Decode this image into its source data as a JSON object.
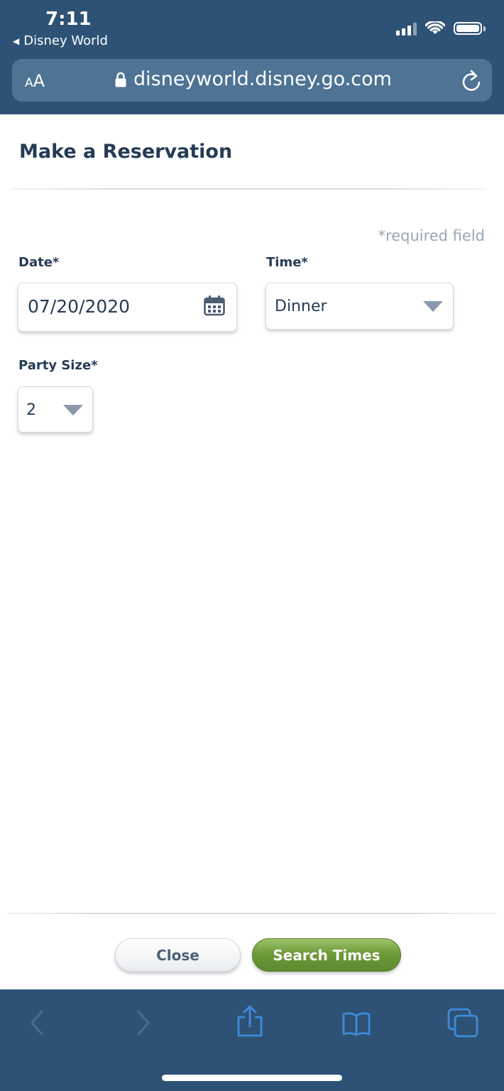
{
  "status_bar": {
    "time": "7:11",
    "back_app": "Disney World"
  },
  "browser": {
    "text_size_small": "A",
    "text_size_large": "A",
    "url": "disneyworld.disney.go.com"
  },
  "page": {
    "title": "Make a Reservation",
    "required_note": "*required field",
    "date": {
      "label": "Date*",
      "value": "07/20/2020"
    },
    "time": {
      "label": "Time*",
      "value": "Dinner"
    },
    "party_size": {
      "label": "Party Size*",
      "value": "2"
    }
  },
  "footer": {
    "close_label": "Close",
    "search_label": "Search Times"
  },
  "colors": {
    "chrome": "#2d5275",
    "url_bar": "#4e7394",
    "heading": "#253b56",
    "toolbar_icon": "#3f8ad9",
    "toolbar_icon_disabled": "#4d6b8a",
    "search_button": "#6f9a3b"
  },
  "icons": [
    "lock-icon",
    "reload-icon",
    "calendar-icon",
    "dropdown-caret-icon",
    "back-icon",
    "forward-icon",
    "share-icon",
    "bookmarks-icon",
    "tabs-icon"
  ]
}
